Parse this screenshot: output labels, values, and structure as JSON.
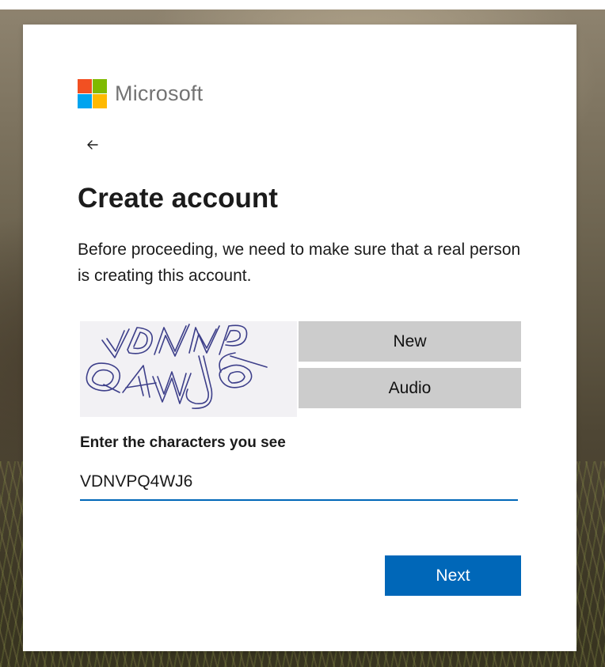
{
  "brand": {
    "name": "Microsoft",
    "logo_colors": [
      "#f25022",
      "#7fba00",
      "#00a4ef",
      "#ffb900"
    ]
  },
  "nav": {
    "back_icon": "arrow-left-icon"
  },
  "page": {
    "title": "Create account",
    "description": "Before proceeding, we need to make sure that a real person is creating this account."
  },
  "captcha": {
    "image_text": "VDNVPQ4WJ6",
    "new_label": "New",
    "audio_label": "Audio",
    "field_label": "Enter the characters you see",
    "field_value": "VDNVPQ4WJ6"
  },
  "actions": {
    "next_label": "Next"
  },
  "colors": {
    "accent": "#0067b8",
    "button_gray": "#cccccc"
  }
}
